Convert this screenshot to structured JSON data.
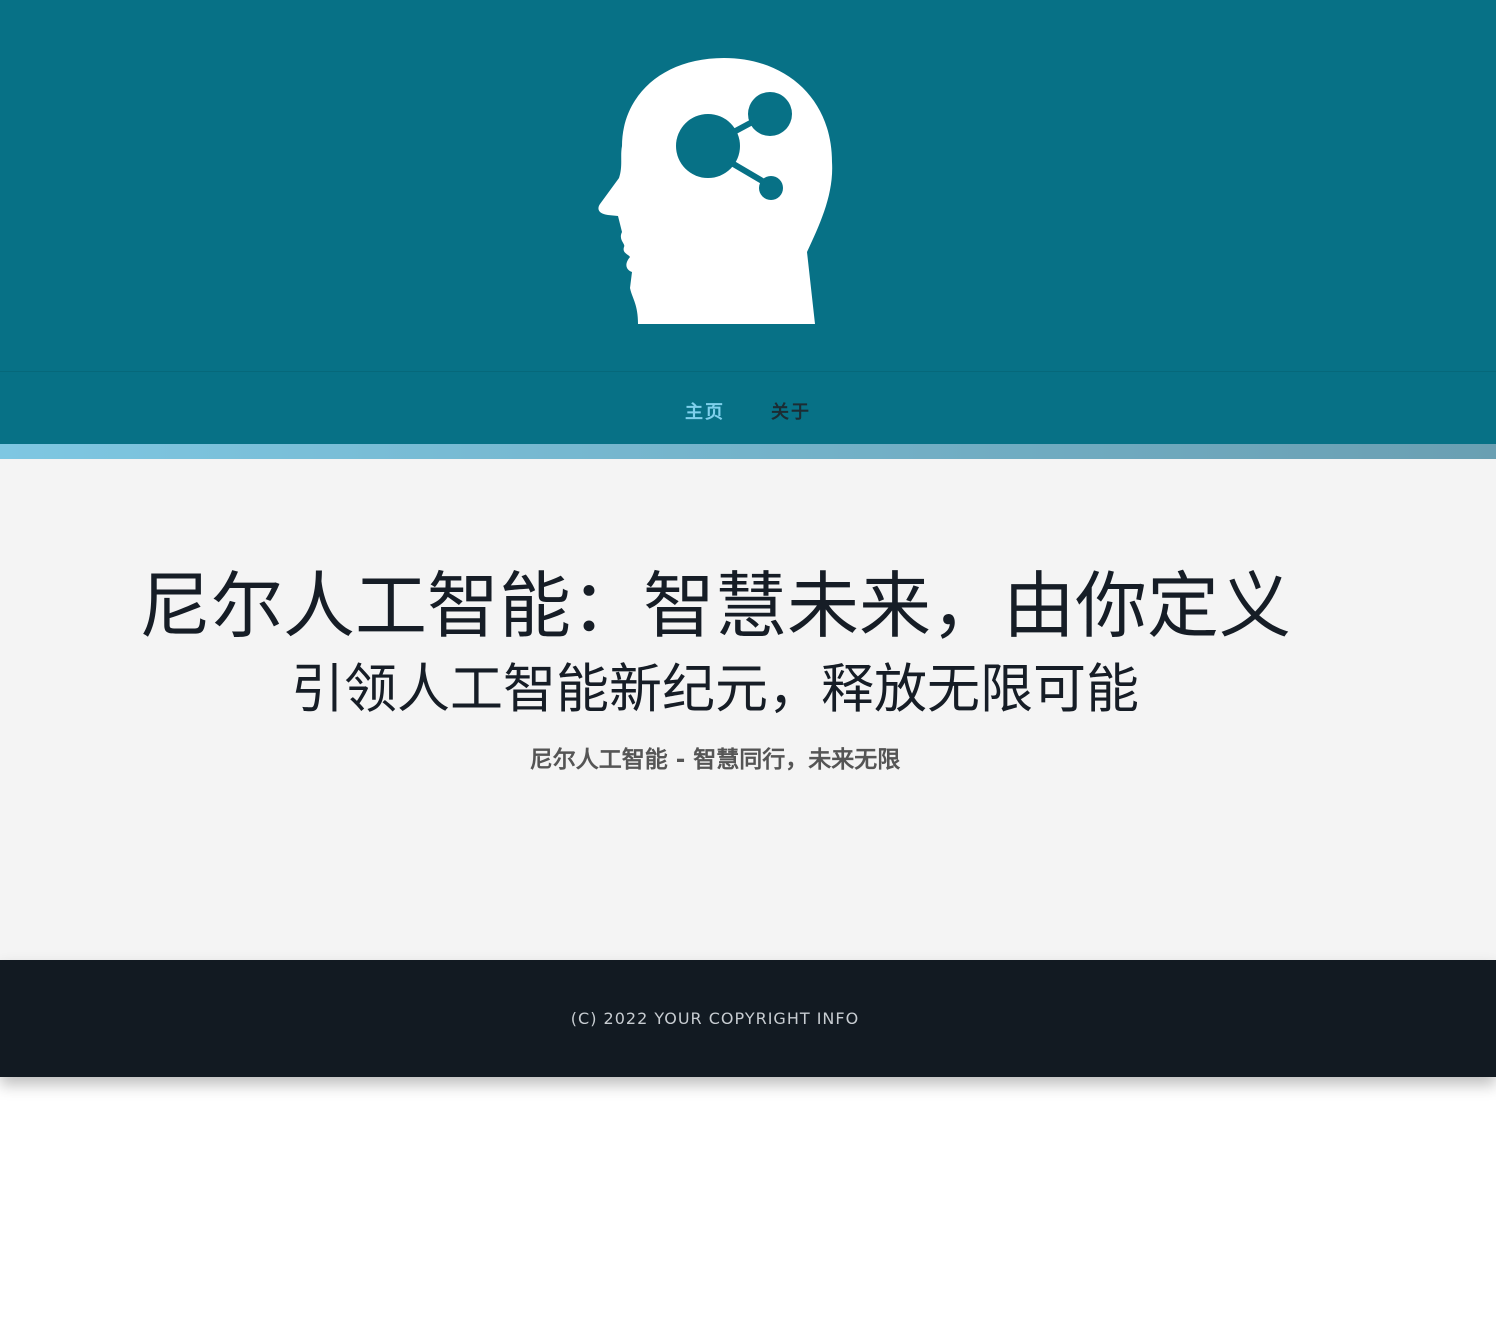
{
  "header": {
    "logo_icon": "head-with-network-icon"
  },
  "nav": {
    "items": [
      {
        "label": "主页",
        "active": true
      },
      {
        "label": "关于",
        "active": false
      }
    ],
    "active_color": "#7fd0ec"
  },
  "hero": {
    "title": "尼尔人工智能：智慧未来，由你定义",
    "subtitle": "引领人工智能新纪元，释放无限可能",
    "tagline": "尼尔人工智能 - 智慧同行，未来无限"
  },
  "footer": {
    "copyright": "(C) 2022 YOUR COPYRIGHT INFO"
  },
  "colors": {
    "header_bg": "#077186",
    "accent_bar": "#7ec7e2",
    "main_bg": "#f4f4f4",
    "footer_bg": "#121a22"
  }
}
